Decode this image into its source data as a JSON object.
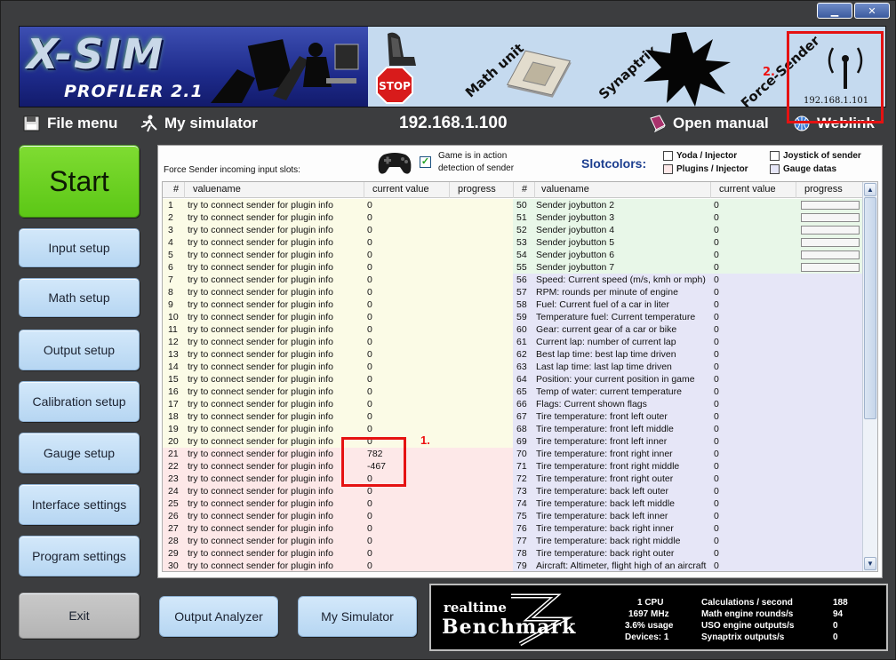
{
  "window": {
    "minimize_icon": "minimize-icon",
    "close_icon": "close-icon",
    "minimize_glyph": "▁",
    "close_glyph": "✕"
  },
  "banner": {
    "logo_brand": "X-SIM",
    "logo_product": "PROFILER 2.1",
    "math_unit": "Math unit",
    "synaptrix": "Synaptrix",
    "force_sender": "Force-Sender",
    "stop_text": "STOP",
    "force_sender_ip": "192.168.1.101",
    "annotation_2": "2."
  },
  "menu": {
    "file_menu": "File menu",
    "my_simulator": "My simulator",
    "ip_address": "192.168.1.100",
    "open_manual": "Open manual",
    "weblink": "Weblink"
  },
  "sidebar": {
    "start": "Start",
    "input_setup": "Input setup",
    "math_setup": "Math setup",
    "output_setup": "Output setup",
    "calibration_setup": "Calibration setup",
    "gauge_setup": "Gauge setup",
    "interface_settings": "Interface settings",
    "program_settings": "Program settings",
    "exit": "Exit"
  },
  "panel": {
    "slots_label": "Force Sender incoming input slots:",
    "game_checkbox_checked": true,
    "game_checkbox_line1": "Game is in action",
    "game_checkbox_line2": "detection of sender",
    "slotcolors_label": "Slotcolors:",
    "legend": [
      {
        "label": "Yoda / Injector",
        "color": "#ffffff"
      },
      {
        "label": "Joystick of sender",
        "color": "#ffffff"
      },
      {
        "label": "Plugins / Injector",
        "color": "#fde8e8"
      },
      {
        "label": "Gauge datas",
        "color": "#e6e6f7"
      }
    ],
    "annotation_1": "1."
  },
  "table": {
    "headers": {
      "num": "#",
      "valuename": "valuename",
      "current_value": "current value",
      "progress": "progress"
    },
    "left_rows": [
      [
        "1",
        "try to connect sender for plugin info",
        "0"
      ],
      [
        "2",
        "try to connect sender for plugin info",
        "0"
      ],
      [
        "3",
        "try to connect sender for plugin info",
        "0"
      ],
      [
        "4",
        "try to connect sender for plugin info",
        "0"
      ],
      [
        "5",
        "try to connect sender for plugin info",
        "0"
      ],
      [
        "6",
        "try to connect sender for plugin info",
        "0"
      ],
      [
        "7",
        "try to connect sender for plugin info",
        "0"
      ],
      [
        "8",
        "try to connect sender for plugin info",
        "0"
      ],
      [
        "9",
        "try to connect sender for plugin info",
        "0"
      ],
      [
        "10",
        "try to connect sender for plugin info",
        "0"
      ],
      [
        "11",
        "try to connect sender for plugin info",
        "0"
      ],
      [
        "12",
        "try to connect sender for plugin info",
        "0"
      ],
      [
        "13",
        "try to connect sender for plugin info",
        "0"
      ],
      [
        "14",
        "try to connect sender for plugin info",
        "0"
      ],
      [
        "15",
        "try to connect sender for plugin info",
        "0"
      ],
      [
        "16",
        "try to connect sender for plugin info",
        "0"
      ],
      [
        "17",
        "try to connect sender for plugin info",
        "0"
      ],
      [
        "18",
        "try to connect sender for plugin info",
        "0"
      ],
      [
        "19",
        "try to connect sender for plugin info",
        "0"
      ],
      [
        "20",
        "try to connect sender for plugin info",
        "0"
      ],
      [
        "21",
        "try to connect sender for plugin info",
        "782"
      ],
      [
        "22",
        "try to connect sender for plugin info",
        "-467"
      ],
      [
        "23",
        "try to connect sender for plugin info",
        "0"
      ],
      [
        "24",
        "try to connect sender for plugin info",
        "0"
      ],
      [
        "25",
        "try to connect sender for plugin info",
        "0"
      ],
      [
        "26",
        "try to connect sender for plugin info",
        "0"
      ],
      [
        "27",
        "try to connect sender for plugin info",
        "0"
      ],
      [
        "28",
        "try to connect sender for plugin info",
        "0"
      ],
      [
        "29",
        "try to connect sender for plugin info",
        "0"
      ],
      [
        "30",
        "try to connect sender for plugin info",
        "0"
      ]
    ],
    "right_rows": [
      [
        "50",
        "Sender joybutton 2",
        "0"
      ],
      [
        "51",
        "Sender joybutton 3",
        "0"
      ],
      [
        "52",
        "Sender joybutton 4",
        "0"
      ],
      [
        "53",
        "Sender joybutton 5",
        "0"
      ],
      [
        "54",
        "Sender joybutton 6",
        "0"
      ],
      [
        "55",
        "Sender joybutton 7",
        "0"
      ],
      [
        "56",
        "Speed: Current speed (m/s, kmh or mph)",
        "0"
      ],
      [
        "57",
        "RPM: rounds per minute of engine",
        "0"
      ],
      [
        "58",
        "Fuel: Current fuel of a car in liter",
        "0"
      ],
      [
        "59",
        "Temperature fuel: Current temperature",
        "0"
      ],
      [
        "60",
        "Gear: current gear of a car or bike",
        "0"
      ],
      [
        "61",
        "Current lap: number of current lap",
        "0"
      ],
      [
        "62",
        "Best lap time: best lap time driven",
        "0"
      ],
      [
        "63",
        "Last lap time: last lap time driven",
        "0"
      ],
      [
        "64",
        "Position: your current position in game",
        "0"
      ],
      [
        "65",
        "Temp of water: current temperature",
        "0"
      ],
      [
        "66",
        "Flags: Current shown flags",
        "0"
      ],
      [
        "67",
        "Tire temperature: front left outer",
        "0"
      ],
      [
        "68",
        "Tire temperature: front left middle",
        "0"
      ],
      [
        "69",
        "Tire temperature: front left inner",
        "0"
      ],
      [
        "70",
        "Tire temperature: front right inner",
        "0"
      ],
      [
        "71",
        "Tire temperature: front right middle",
        "0"
      ],
      [
        "72",
        "Tire temperature: front right outer",
        "0"
      ],
      [
        "73",
        "Tire temperature: back left outer",
        "0"
      ],
      [
        "74",
        "Tire temperature: back left middle",
        "0"
      ],
      [
        "75",
        "Tire temperature: back left inner",
        "0"
      ],
      [
        "76",
        "Tire temperature: back right inner",
        "0"
      ],
      [
        "77",
        "Tire temperature: back right middle",
        "0"
      ],
      [
        "78",
        "Tire temperature: back right outer",
        "0"
      ],
      [
        "79",
        "Aircraft: Altimeter, flight high of an aircraft",
        "0"
      ]
    ],
    "progress_bar_rows": 6
  },
  "bottom": {
    "output_analyzer": "Output Analyzer",
    "my_simulator": "My Simulator"
  },
  "benchmark": {
    "logo_line1": "realtime",
    "logo_line2": "Benchmark",
    "cpu": "1 CPU",
    "mhz": "1697 MHz",
    "usage": "3.6% usage",
    "devices": "Devices: 1",
    "calc_label": "Calculations / second",
    "calc_value": "188",
    "math_label": "Math engine rounds/s",
    "math_value": "94",
    "uso_label": "USO engine outputs/s",
    "uso_value": "0",
    "syn_label": "Synaptrix outputs/s",
    "syn_value": "0"
  },
  "colors": {
    "start_green": "#6fd324",
    "button_blue": "#c7e0f6",
    "highlight_red": "#e51212",
    "yellow_slot": "#fbfbe6",
    "pink_slot": "#fde8e8",
    "green_slot": "#e8f7e8",
    "gauge_slot": "#e6e6f7"
  }
}
